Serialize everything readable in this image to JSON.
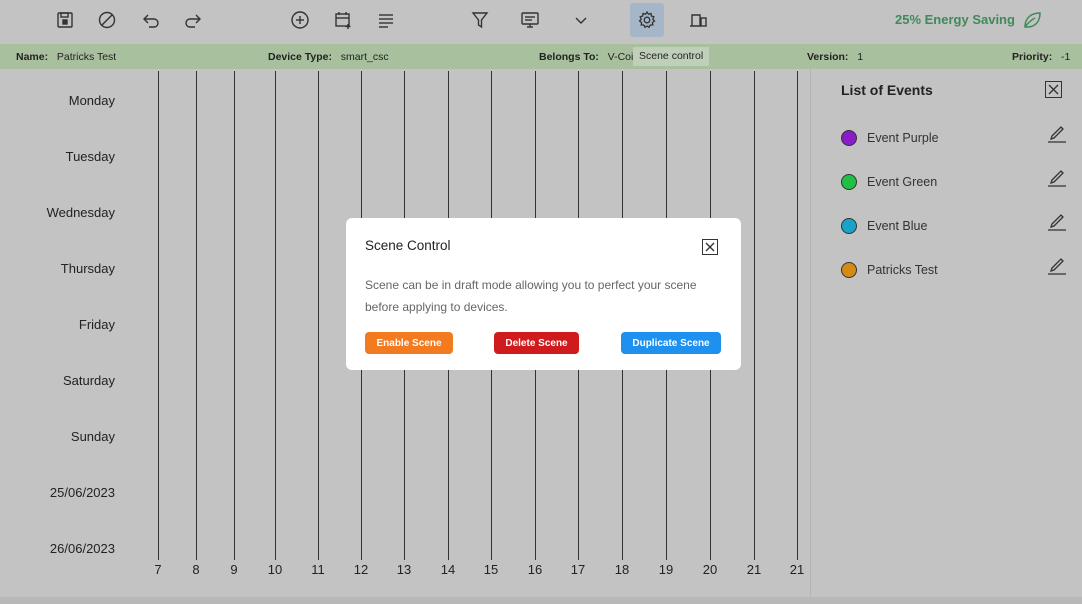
{
  "toolbar": {
    "icons": [
      "save-icon",
      "clear-icon",
      "undo-icon",
      "redo-icon",
      "add-circle-icon",
      "calendar-add-icon",
      "list-icon",
      "filter-icon",
      "display-icon",
      "chevron-down-icon",
      "settings-icon",
      "devices-icon"
    ],
    "energy_saving": "25% Energy Saving",
    "energy_color": "#3f8a5b"
  },
  "info": {
    "name_label": "Name:",
    "name_value": "Patricks Test",
    "device_type_label": "Device Type:",
    "device_type_value": "smart_csc",
    "belongs_to_label": "Belongs To:",
    "belongs_to_value": "V-Coi",
    "tooltip": "Scene control",
    "version_label": "Version:",
    "version_value": "1",
    "priority_label": "Priority:",
    "priority_value": "-1"
  },
  "schedule": {
    "days": [
      "Monday",
      "Tuesday",
      "Wednesday",
      "Thursday",
      "Friday",
      "Saturday",
      "Sunday",
      "25/06/2023",
      "26/06/2023"
    ],
    "hours": [
      "7",
      "8",
      "9",
      "10",
      "11",
      "12",
      "13",
      "14",
      "15",
      "16",
      "17",
      "18",
      "19",
      "20",
      "21",
      "21"
    ]
  },
  "panel": {
    "title": "List of Events",
    "events": [
      {
        "label": "Event Purple",
        "color": "#8a1cc9"
      },
      {
        "label": "Event Green",
        "color": "#1fc043"
      },
      {
        "label": "Event Blue",
        "color": "#1aa3c9"
      },
      {
        "label": "Patricks Test",
        "color": "#d48b14"
      }
    ]
  },
  "modal": {
    "title": "Scene Control",
    "text": "Scene can be in draft mode allowing you to perfect your scene before applying to devices.",
    "enable_label": "Enable Scene",
    "delete_label": "Delete Scene",
    "duplicate_label": "Duplicate Scene",
    "colors": {
      "enable": "#f47a1f",
      "delete": "#cf1b1b",
      "duplicate": "#1e90ef"
    }
  }
}
